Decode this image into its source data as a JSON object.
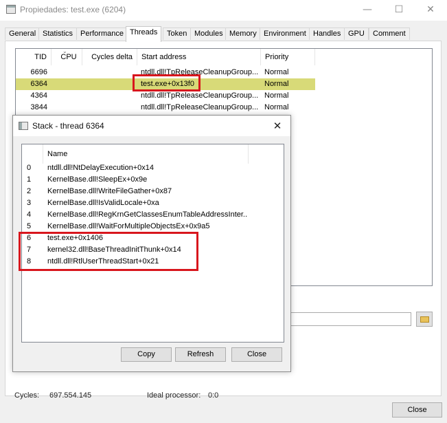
{
  "window": {
    "title": "Propiedades: test.exe (6204)",
    "minimize_glyph": "—",
    "maximize_glyph": "☐",
    "close_glyph": "✕"
  },
  "tabs": [
    {
      "label": "General"
    },
    {
      "label": "Statistics"
    },
    {
      "label": "Performance"
    },
    {
      "label": "Threads",
      "active": true
    },
    {
      "label": "Token"
    },
    {
      "label": "Modules"
    },
    {
      "label": "Memory"
    },
    {
      "label": "Environment"
    },
    {
      "label": "Handles"
    },
    {
      "label": "GPU"
    },
    {
      "label": "Comment"
    }
  ],
  "threads": {
    "columns": [
      "TID",
      "CPU",
      "Cycles delta",
      "Start address",
      "Priority"
    ],
    "rows": [
      {
        "tid": "6696",
        "start": "ntdll.dll!TpReleaseCleanupGroup...",
        "priority": "Normal"
      },
      {
        "tid": "6364",
        "start": "test.exe+0x13f0",
        "priority": "Normal",
        "selected": true
      },
      {
        "tid": "4364",
        "start": "ntdll.dll!TpReleaseCleanupGroup...",
        "priority": "Normal"
      },
      {
        "tid": "3844",
        "start": "ntdll.dll!TpReleaseCleanupGroup...",
        "priority": "Normal"
      }
    ]
  },
  "info": {
    "cycles_label": "Cycles:",
    "cycles_value": "697.554.145",
    "ideal_label": "Ideal processor:",
    "ideal_value": "0:0"
  },
  "main_close": "Close",
  "dialog": {
    "title": "Stack - thread 6364",
    "close_glyph": "✕",
    "column_name": "Name",
    "frames": [
      {
        "index": "0",
        "name": "ntdll.dll!NtDelayExecution+0x14"
      },
      {
        "index": "1",
        "name": "KernelBase.dll!SleepEx+0x9e"
      },
      {
        "index": "2",
        "name": "KernelBase.dll!WriteFileGather+0x87"
      },
      {
        "index": "3",
        "name": "KernelBase.dll!IsValidLocale+0xa"
      },
      {
        "index": "4",
        "name": "KernelBase.dll!RegKrnGetClassesEnumTableAddressInter..."
      },
      {
        "index": "5",
        "name": "KernelBase.dll!WaitForMultipleObjectsEx+0x9a5"
      },
      {
        "index": "6",
        "name": "test.exe+0x1406"
      },
      {
        "index": "7",
        "name": "kernel32.dll!BaseThreadInitThunk+0x14"
      },
      {
        "index": "8",
        "name": "ntdll.dll!RtlUserThreadStart+0x21"
      }
    ],
    "copy": "Copy",
    "refresh": "Refresh",
    "close": "Close"
  },
  "colors": {
    "selection": "#d8da78",
    "highlight_box": "#d8161d"
  }
}
